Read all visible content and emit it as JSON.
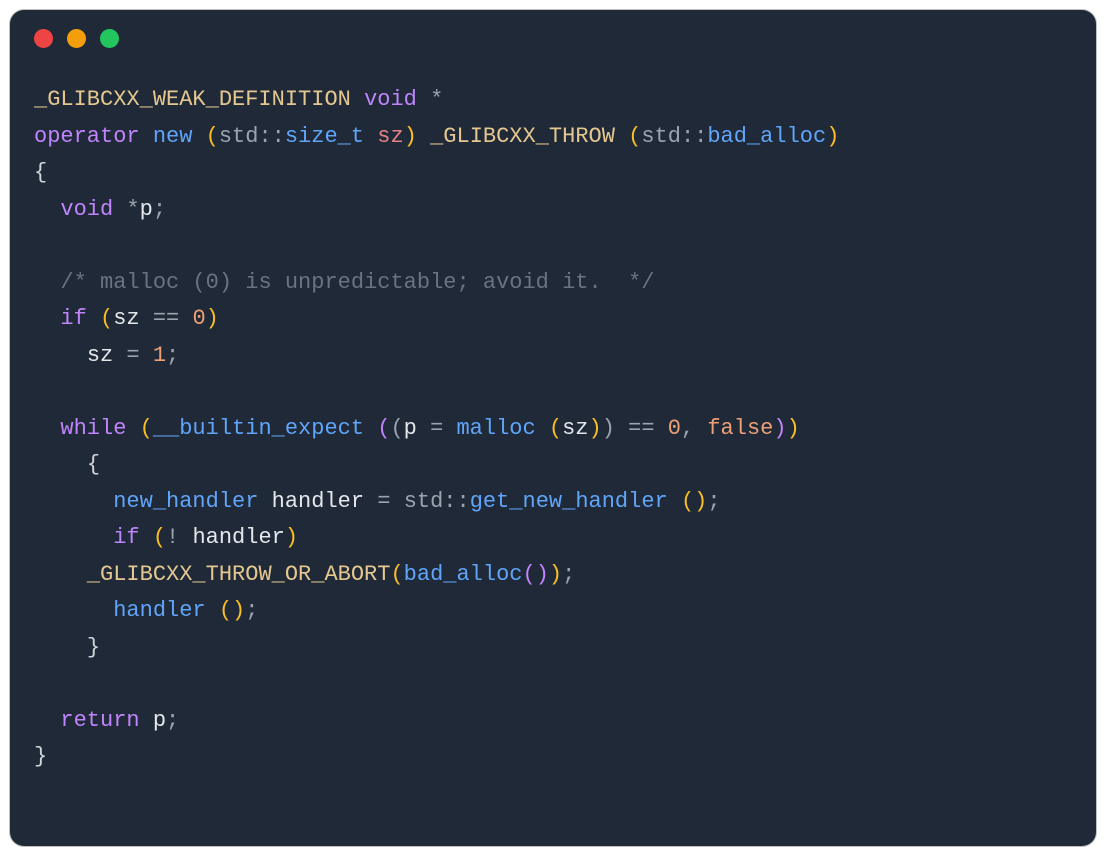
{
  "window": {
    "traffic_lights": [
      "close",
      "minimize",
      "zoom"
    ]
  },
  "code": {
    "t_glibcxx_weak_def": "_GLIBCXX_WEAK_DEFINITION",
    "t_void": "void",
    "t_star": "*",
    "t_operator": "operator",
    "t_new": "new",
    "t_std": "std",
    "t_coloncolon": "::",
    "t_size_t": "size_t",
    "t_sz": "sz",
    "t_glibcxx_throw": "_GLIBCXX_THROW",
    "t_bad_alloc": "bad_alloc",
    "t_p": "p",
    "t_comment": "/* malloc (0) is unpredictable; avoid it.  */",
    "t_if": "if",
    "t_eqeq": "==",
    "t_zero": "0",
    "t_eq": "=",
    "t_one": "1",
    "t_while": "while",
    "t_builtin_expect": "__builtin_expect",
    "t_malloc": "malloc",
    "t_false": "false",
    "t_new_handler": "new_handler",
    "t_handler": "handler",
    "t_get_new_handler": "get_new_handler",
    "t_not": "!",
    "t_glibcxx_throw_or_abort": "_GLIBCXX_THROW_OR_ABORT",
    "t_return": "return",
    "t_lbrace": "{",
    "t_rbrace": "}",
    "t_lparen": "(",
    "t_rparen": ")",
    "t_semi": ";",
    "t_comma": ","
  }
}
